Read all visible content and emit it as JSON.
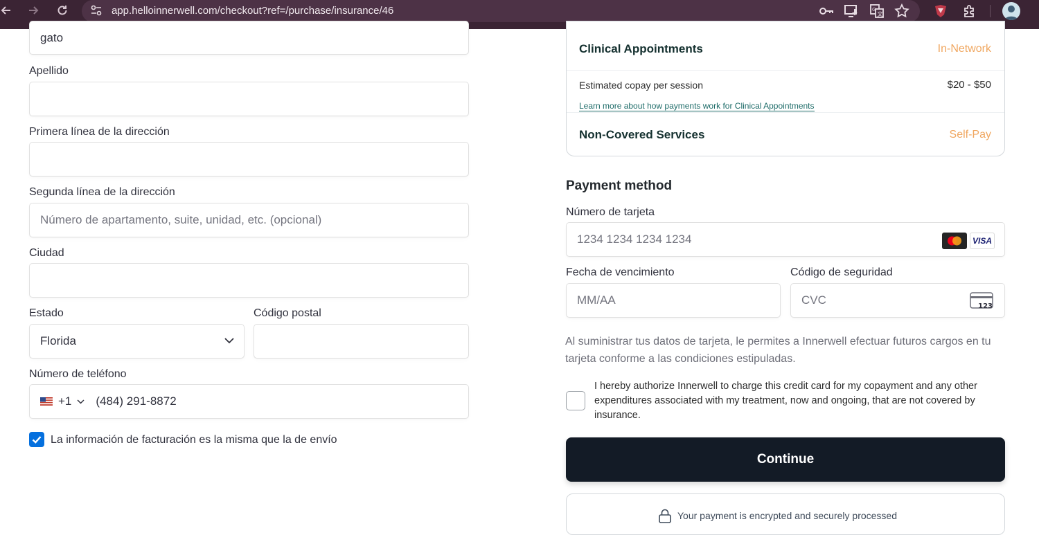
{
  "browser": {
    "url": "app.helloinnerwell.com/checkout?ref=/purchase/insurance/46",
    "icons": [
      "back-icon",
      "forward-icon",
      "reload-icon",
      "site-settings-icon",
      "password-key-icon",
      "install-app-icon",
      "translate-icon",
      "bookmark-star-icon",
      "extension-shield-icon",
      "extensions-puzzle-icon",
      "profile-avatar"
    ]
  },
  "billing_form": {
    "first_name_value": "gato",
    "last_name_label": "Apellido",
    "last_name_value": "",
    "address1_label": "Primera línea de la dirección",
    "address1_value": "",
    "address2_label": "Segunda línea de la dirección",
    "address2_placeholder": "Número de apartamento, suite, unidad, etc. (opcional)",
    "city_label": "Ciudad",
    "city_value": "",
    "state_label": "Estado",
    "state_value": "Florida",
    "zip_label": "Código postal",
    "zip_value": "",
    "phone_label": "Número de teléfono",
    "phone_country_code": "+1",
    "phone_flag": "🇺🇸",
    "phone_value": "(484) 291-8872",
    "same_billing_label": "La información de facturación es la misma que la de envío",
    "same_billing_checked": true
  },
  "coverage": {
    "clinical_title": "Clinical Appointments",
    "clinical_status": "In-Network",
    "copay_label": "Estimated copay per session",
    "copay_value": "$20 - $50",
    "learn_more_link": "Learn more about how payments work for Clinical Appointments",
    "noncovered_title": "Non-Covered Services",
    "noncovered_status": "Self-Pay",
    "status_color": "#f0a760"
  },
  "payment": {
    "section_title": "Payment method",
    "card_number_label": "Número de tarjeta",
    "card_number_placeholder": "1234 1234 1234 1234",
    "card_brands": [
      "mastercard",
      "VISA"
    ],
    "expiry_label": "Fecha de vencimiento",
    "expiry_placeholder": "MM/AA",
    "cvc_label": "Código de seguridad",
    "cvc_placeholder": "CVC",
    "cvc_icon_text": "123",
    "consent_text": "Al suministrar tus datos de tarjeta, le permites a Innerwell efectuar futuros cargos en tu tarjeta conforme a las condiciones estipuladas.",
    "authorize_text": "I hereby authorize Innerwell to charge this credit card for my copayment and any other expenditures associated with my treatment, now and ongoing, that are not covered by insurance.",
    "authorize_checked": false,
    "continue_label": "Continue",
    "secure_text": "Your payment is encrypted and securely processed",
    "button_color": "#131b26",
    "checkbox_color": "#0570de"
  }
}
